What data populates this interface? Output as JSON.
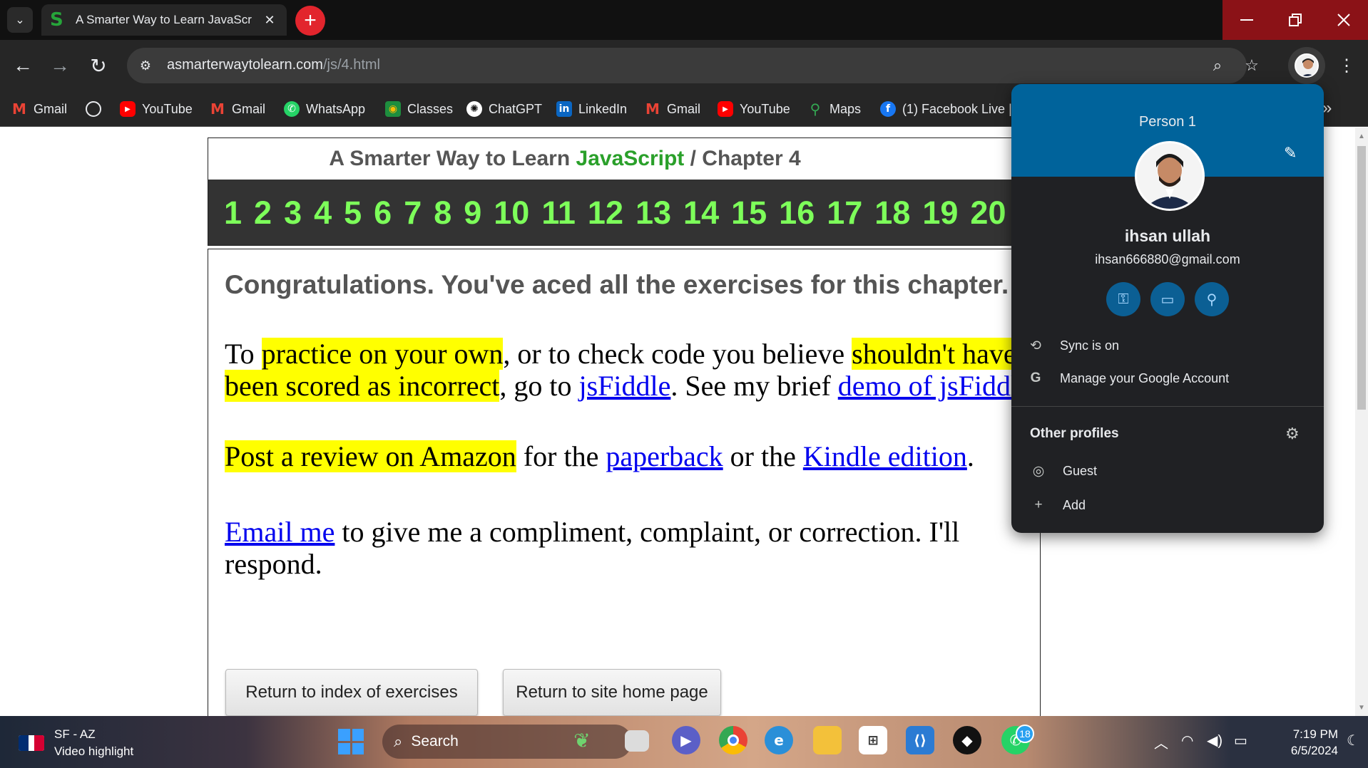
{
  "browser": {
    "tab": {
      "title": "A Smarter Way to Learn JavaScr",
      "favicon": "S"
    },
    "new_tab_symbol": "+",
    "url": {
      "host": "asmarterwaytolearn.com",
      "path": "/js/4.html"
    }
  },
  "bookmarks": [
    {
      "label": "Gmail",
      "icon": "gmail-icon",
      "glyph": "M"
    },
    {
      "label": "",
      "icon": "globe-icon",
      "glyph": ""
    },
    {
      "label": "YouTube",
      "icon": "youtube-icon",
      "glyph": "▶"
    },
    {
      "label": "Gmail",
      "icon": "gmail-icon",
      "glyph": "M"
    },
    {
      "label": "WhatsApp",
      "icon": "whatsapp-icon",
      "glyph": "✆"
    },
    {
      "label": "Classes",
      "icon": "classroom-icon",
      "glyph": "◉"
    },
    {
      "label": "ChatGPT",
      "icon": "chatgpt-icon",
      "glyph": "✺"
    },
    {
      "label": "LinkedIn",
      "icon": "linkedin-icon",
      "glyph": "in"
    },
    {
      "label": "Gmail",
      "icon": "gmail-icon",
      "glyph": "M"
    },
    {
      "label": "YouTube",
      "icon": "youtube-icon",
      "glyph": "▶"
    },
    {
      "label": "Maps",
      "icon": "maps-icon",
      "glyph": "⚲"
    },
    {
      "label": "(1) Facebook Live |",
      "icon": "facebook-icon",
      "glyph": "f"
    }
  ],
  "page": {
    "header": {
      "title_prefix": "A Smarter Way to Learn ",
      "title_js": "JavaScript",
      "title_sep": " / ",
      "title_chapter": "Chapter 4"
    },
    "chapters": [
      "1",
      "2",
      "3",
      "4",
      "5",
      "6",
      "7",
      "8",
      "9",
      "10",
      "11",
      "12",
      "13",
      "14",
      "15",
      "16",
      "17",
      "18",
      "19",
      "20"
    ],
    "congrats": "Congratulations. You've aced all the exercises for this chapter.",
    "para1": {
      "t1": "To ",
      "h1": "practice on your own",
      "t2": ", or to check code you believe ",
      "h2": "shouldn't have been scored as incorrect",
      "t3": ", go to ",
      "l1": "jsFiddle",
      "t4": ". See my brief ",
      "l2": "demo of jsFiddle",
      "t5": "."
    },
    "para2": {
      "h1": "Post a review on Amazon",
      "t1": " for the ",
      "l1": "paperback",
      "t2": " or the ",
      "l2": "Kindle edition",
      "t3": "."
    },
    "para3": {
      "l1": "Email me",
      "t1": " to give me a compliment, complaint, or correction. I'll respond."
    },
    "buttons": {
      "index": "Return to index of exercises",
      "home": "Return to site home page"
    }
  },
  "profile_menu": {
    "header": "Person 1",
    "name": "ihsan ullah",
    "email": "ihsan666880@gmail.com",
    "sync": "Sync is on",
    "manage": "Manage your Google Account",
    "other_profiles": "Other profiles",
    "guest": "Guest",
    "add": "Add"
  },
  "taskbar": {
    "weather_line1": "SF - AZ",
    "weather_line2": "Video highlight",
    "search": "Search",
    "whatsapp_badge": "18",
    "time": "7:19 PM",
    "date": "6/5/2024"
  },
  "colors": {
    "accent_green": "#2aa02a",
    "chapter_green": "#7dff5a",
    "highlight": "#ffff00",
    "profile_header": "#00639b",
    "window_controls": "#8b1217"
  }
}
